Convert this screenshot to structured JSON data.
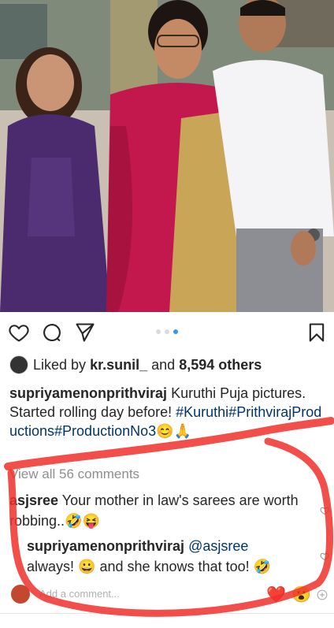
{
  "post": {
    "liked_by_prefix": "Liked by",
    "liked_by_user": "kr.sunil_",
    "liked_by_and": "and",
    "likes_count": "8,594 others",
    "caption_user": "supriyamenonprithviraj",
    "caption_text": "Kuruthi Puja pictures. Started rolling day before!",
    "caption_tags": "#Kuruthi#PrithvirajProductions#ProductionNo3",
    "caption_emojis": "😊🙏",
    "view_all_comments": "View all 56 comments",
    "carousel_pages": 3,
    "carousel_active": 3
  },
  "comments": [
    {
      "user": "asjsree",
      "text": "Your mother in law's sarees are worth robbing..",
      "emojis": "🤣😝"
    },
    {
      "user": "supriyamenonprithviraj",
      "mention": "@asjsree",
      "text_a": "always!",
      "emoji_a": "😀",
      "text_b": "and she knows that too!",
      "emoji_b": "🤣"
    }
  ],
  "add_comment": {
    "placeholder": "Add a comment...",
    "quick_emojis": [
      "❤️",
      "😮"
    ]
  },
  "colors": {
    "accent_blue": "#3897f0",
    "hashtag": "#003569",
    "highlight_red": "#f0302a",
    "muted": "#8e8e8e"
  },
  "icons": [
    "heart-icon",
    "comment-icon",
    "share-icon",
    "bookmark-icon",
    "add-circle-icon"
  ]
}
